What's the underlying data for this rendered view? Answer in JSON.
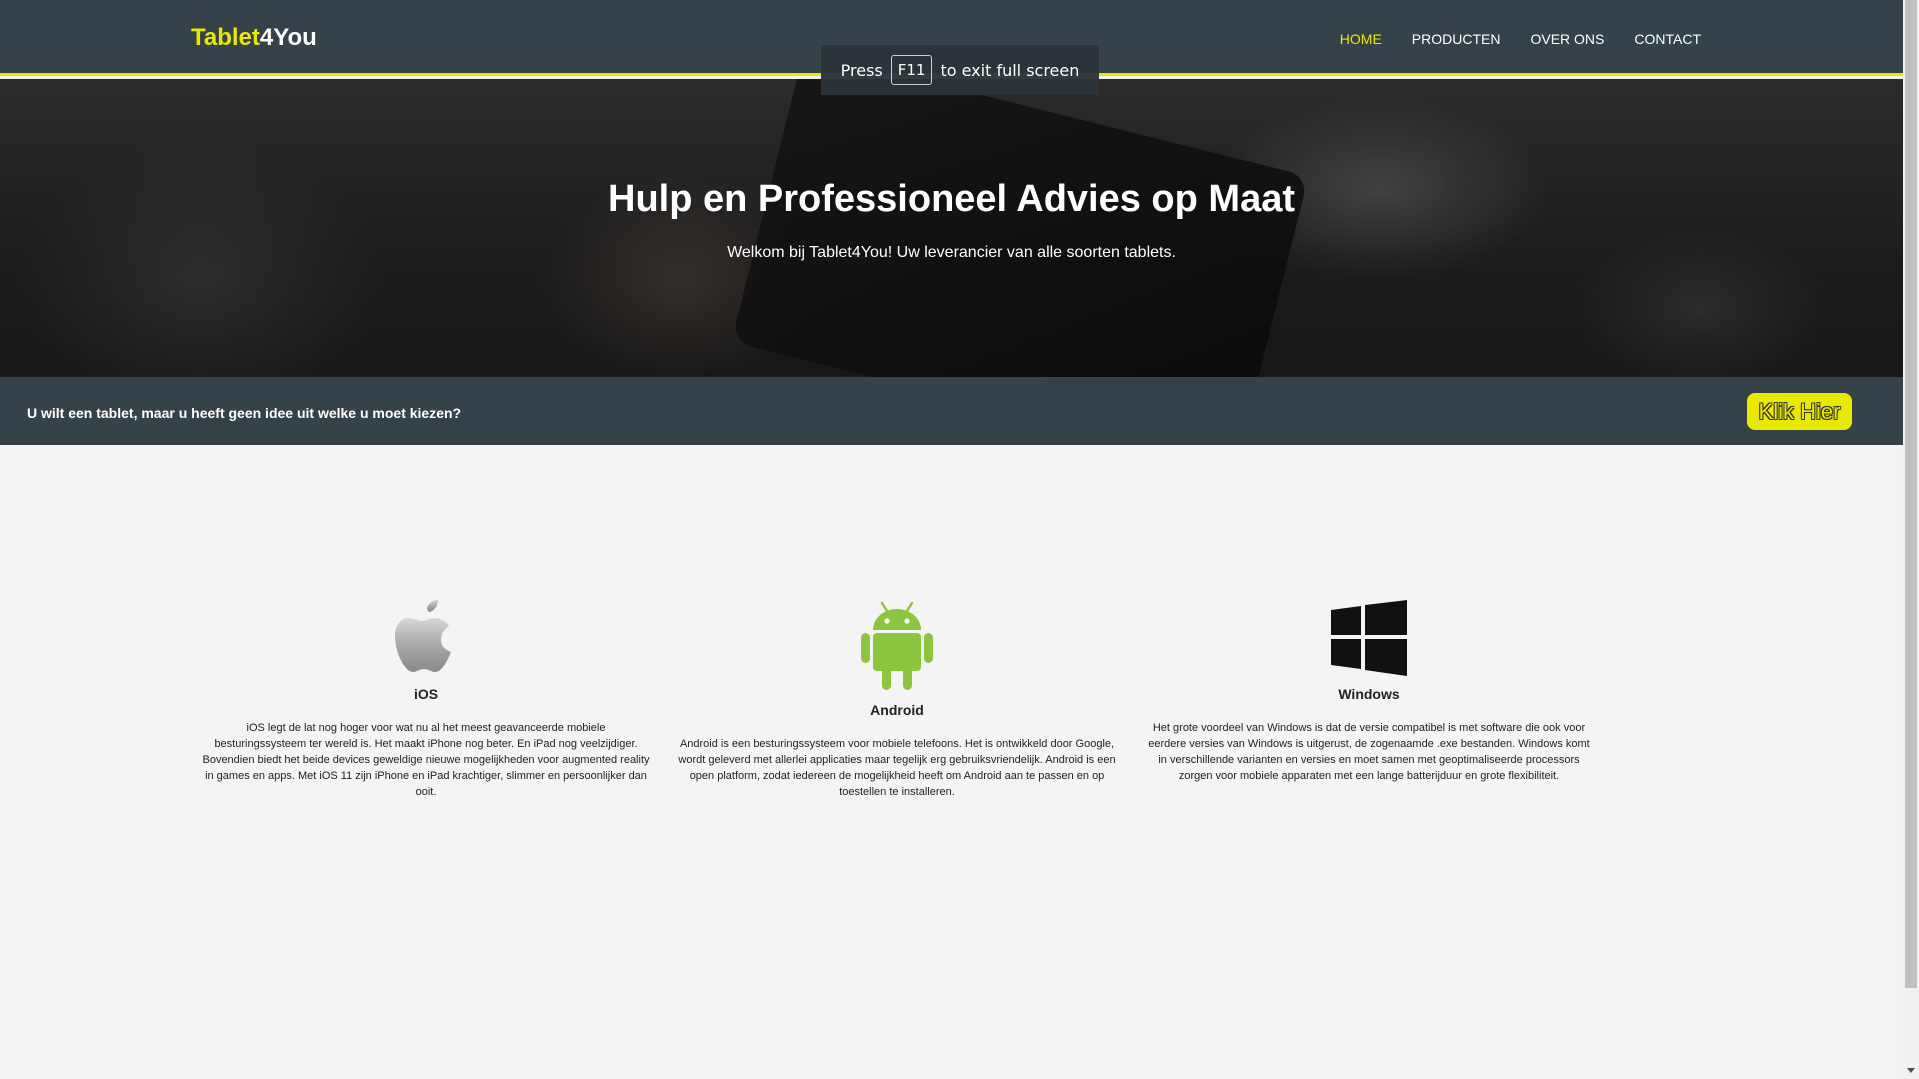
{
  "header": {
    "logo_part1": "Tablet",
    "logo_part2": "4You",
    "nav": [
      "HOME",
      "PRODUCTEN",
      "OVER ONS",
      "CONTACT"
    ],
    "active_nav": "HOME",
    "accent_color": "#e8e800",
    "bg_color": "#35424a"
  },
  "fullscreen_toast": {
    "prefix": "Press",
    "key": "F11",
    "suffix": "to exit full screen"
  },
  "hero": {
    "title": "Hulp en Professioneel Advies op Maat",
    "subtitle": "Welkom bij Tablet4You! Uw leverancier van alle soorten tablets."
  },
  "cta": {
    "question": "U wilt een tablet, maar u heeft geen idee uit welke u moet kiezen?",
    "button_label": "Klik Hier"
  },
  "platforms": [
    {
      "icon": "apple-icon",
      "title": "iOS",
      "text": "iOS legt de lat nog hoger voor wat nu al het meest geavanceerde mobiele besturingssysteem ter wereld is. Het maakt iPhone nog beter. En iPad nog veelzijdiger. Bovendien biedt het beide devices geweldige nieuwe mogelijkheden voor augmented reality in games en apps. Met iOS 11 zijn iPhone en iPad krachtiger, slimmer en persoonlijker dan ooit."
    },
    {
      "icon": "android-icon",
      "title": "Android",
      "text": "Android is een besturingssysteem voor mobiele telefoons. Het is ontwikkeld door Google, wordt geleverd met allerlei applicaties maar tegelijk erg gebruiksvriendelijk. Android is een open platform, zodat iedereen de mogelijkheid heeft om Android aan te passen en op toestellen te installeren."
    },
    {
      "icon": "windows-icon",
      "title": "Windows",
      "text": "Het grote voordeel van Windows is dat de versie compatibel is met software die ook voor eerdere versies van Windows is uitgerust, de zogenaamde .exe bestanden. Windows komt in verschillende varianten en versies en moet samen met geoptimaliseerde processors zorgen voor mobiele apparaten met een lange batterijduur en grote flexibiliteit."
    }
  ]
}
